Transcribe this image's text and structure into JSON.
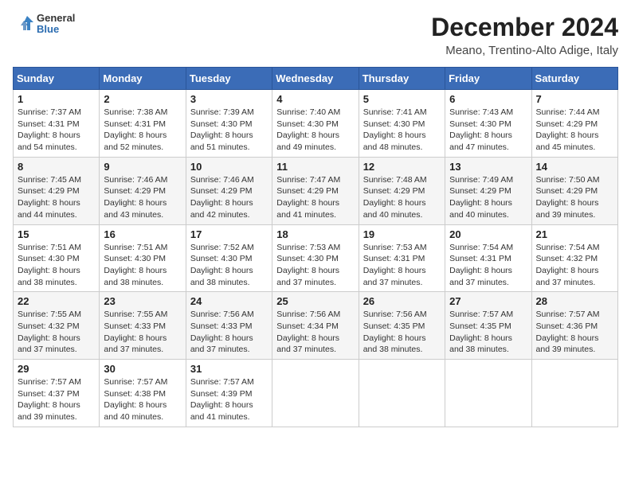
{
  "header": {
    "logo_line1": "General",
    "logo_line2": "Blue",
    "title": "December 2024",
    "subtitle": "Meano, Trentino-Alto Adige, Italy"
  },
  "weekdays": [
    "Sunday",
    "Monday",
    "Tuesday",
    "Wednesday",
    "Thursday",
    "Friday",
    "Saturday"
  ],
  "weeks": [
    [
      {
        "day": "1",
        "sunrise": "7:37 AM",
        "sunset": "4:31 PM",
        "daylight": "8 hours and 54 minutes."
      },
      {
        "day": "2",
        "sunrise": "7:38 AM",
        "sunset": "4:31 PM",
        "daylight": "8 hours and 52 minutes."
      },
      {
        "day": "3",
        "sunrise": "7:39 AM",
        "sunset": "4:30 PM",
        "daylight": "8 hours and 51 minutes."
      },
      {
        "day": "4",
        "sunrise": "7:40 AM",
        "sunset": "4:30 PM",
        "daylight": "8 hours and 49 minutes."
      },
      {
        "day": "5",
        "sunrise": "7:41 AM",
        "sunset": "4:30 PM",
        "daylight": "8 hours and 48 minutes."
      },
      {
        "day": "6",
        "sunrise": "7:43 AM",
        "sunset": "4:30 PM",
        "daylight": "8 hours and 47 minutes."
      },
      {
        "day": "7",
        "sunrise": "7:44 AM",
        "sunset": "4:29 PM",
        "daylight": "8 hours and 45 minutes."
      }
    ],
    [
      {
        "day": "8",
        "sunrise": "7:45 AM",
        "sunset": "4:29 PM",
        "daylight": "8 hours and 44 minutes."
      },
      {
        "day": "9",
        "sunrise": "7:46 AM",
        "sunset": "4:29 PM",
        "daylight": "8 hours and 43 minutes."
      },
      {
        "day": "10",
        "sunrise": "7:46 AM",
        "sunset": "4:29 PM",
        "daylight": "8 hours and 42 minutes."
      },
      {
        "day": "11",
        "sunrise": "7:47 AM",
        "sunset": "4:29 PM",
        "daylight": "8 hours and 41 minutes."
      },
      {
        "day": "12",
        "sunrise": "7:48 AM",
        "sunset": "4:29 PM",
        "daylight": "8 hours and 40 minutes."
      },
      {
        "day": "13",
        "sunrise": "7:49 AM",
        "sunset": "4:29 PM",
        "daylight": "8 hours and 40 minutes."
      },
      {
        "day": "14",
        "sunrise": "7:50 AM",
        "sunset": "4:29 PM",
        "daylight": "8 hours and 39 minutes."
      }
    ],
    [
      {
        "day": "15",
        "sunrise": "7:51 AM",
        "sunset": "4:30 PM",
        "daylight": "8 hours and 38 minutes."
      },
      {
        "day": "16",
        "sunrise": "7:51 AM",
        "sunset": "4:30 PM",
        "daylight": "8 hours and 38 minutes."
      },
      {
        "day": "17",
        "sunrise": "7:52 AM",
        "sunset": "4:30 PM",
        "daylight": "8 hours and 38 minutes."
      },
      {
        "day": "18",
        "sunrise": "7:53 AM",
        "sunset": "4:30 PM",
        "daylight": "8 hours and 37 minutes."
      },
      {
        "day": "19",
        "sunrise": "7:53 AM",
        "sunset": "4:31 PM",
        "daylight": "8 hours and 37 minutes."
      },
      {
        "day": "20",
        "sunrise": "7:54 AM",
        "sunset": "4:31 PM",
        "daylight": "8 hours and 37 minutes."
      },
      {
        "day": "21",
        "sunrise": "7:54 AM",
        "sunset": "4:32 PM",
        "daylight": "8 hours and 37 minutes."
      }
    ],
    [
      {
        "day": "22",
        "sunrise": "7:55 AM",
        "sunset": "4:32 PM",
        "daylight": "8 hours and 37 minutes."
      },
      {
        "day": "23",
        "sunrise": "7:55 AM",
        "sunset": "4:33 PM",
        "daylight": "8 hours and 37 minutes."
      },
      {
        "day": "24",
        "sunrise": "7:56 AM",
        "sunset": "4:33 PM",
        "daylight": "8 hours and 37 minutes."
      },
      {
        "day": "25",
        "sunrise": "7:56 AM",
        "sunset": "4:34 PM",
        "daylight": "8 hours and 37 minutes."
      },
      {
        "day": "26",
        "sunrise": "7:56 AM",
        "sunset": "4:35 PM",
        "daylight": "8 hours and 38 minutes."
      },
      {
        "day": "27",
        "sunrise": "7:57 AM",
        "sunset": "4:35 PM",
        "daylight": "8 hours and 38 minutes."
      },
      {
        "day": "28",
        "sunrise": "7:57 AM",
        "sunset": "4:36 PM",
        "daylight": "8 hours and 39 minutes."
      }
    ],
    [
      {
        "day": "29",
        "sunrise": "7:57 AM",
        "sunset": "4:37 PM",
        "daylight": "8 hours and 39 minutes."
      },
      {
        "day": "30",
        "sunrise": "7:57 AM",
        "sunset": "4:38 PM",
        "daylight": "8 hours and 40 minutes."
      },
      {
        "day": "31",
        "sunrise": "7:57 AM",
        "sunset": "4:39 PM",
        "daylight": "8 hours and 41 minutes."
      },
      null,
      null,
      null,
      null
    ]
  ]
}
